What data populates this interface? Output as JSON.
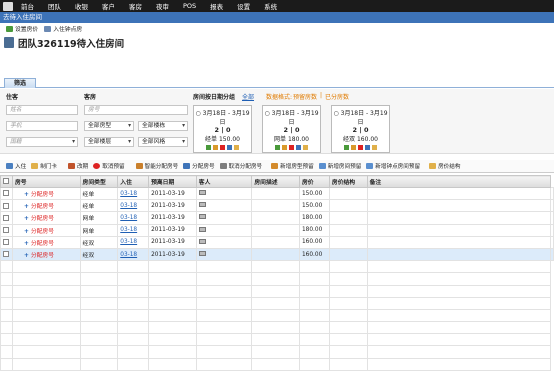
{
  "nav": {
    "items": [
      "前台",
      "团队",
      "收银",
      "客户",
      "客房",
      "夜审",
      "POS",
      "报表",
      "设置",
      "系统"
    ]
  },
  "breadcrumb": "去待入住房间",
  "toolbar": {
    "set_price": "设置房价",
    "checkin_hour": "入住钟点房"
  },
  "page_title": "团队326119待入住房间",
  "filter": {
    "tab": "筛选",
    "group_label": "住客",
    "guest_label": "客房",
    "room_stats_label": "房间按日期分组",
    "room_stats_all": "全部",
    "data_format_label": "数据格式:",
    "data_format_value": "预留房数",
    "data_format_sep": "|",
    "data_format_other": "已分房数",
    "name_placeholder": "姓名",
    "phone_placeholder": "手机",
    "country_placeholder": "国籍",
    "room_no_placeholder": "房号",
    "room_type_select": "全部房型",
    "building_select": "全部楼栋",
    "floor_select": "全部楼层",
    "style_select": "全部风格"
  },
  "room_groups": [
    {
      "dates": "3月18日 - 3月19日",
      "counts": "2 | 0",
      "type": "经单",
      "price": "150.00"
    },
    {
      "dates": "3月18日 - 3月19日",
      "counts": "2 | 0",
      "type": "网单",
      "price": "180.00"
    },
    {
      "dates": "3月18日 - 3月19日",
      "counts": "2 | 0",
      "type": "经双",
      "price": "160.00"
    }
  ],
  "actions": {
    "checkin": "入住",
    "make_card": "制门卡",
    "change_date": "改期",
    "cancel_reserve": "取消预留",
    "smart_assign": "智能分配房号",
    "assign_room": "分配房号",
    "cancel_assign": "取消分配房号",
    "add_type_reserve": "新增房型预留",
    "add_room_reserve": "新增房间预留",
    "add_hourly_reserve": "新增钟点房间预留",
    "price_structure": "房价结构"
  },
  "table": {
    "headers": [
      "房号",
      "房间类型",
      "入住",
      "预离日期",
      "客人",
      "房间描述",
      "房价",
      "房价结构",
      "备注"
    ],
    "assign_label": "分配房号",
    "rows": [
      {
        "type": "经单",
        "checkin": "03-18",
        "depart": "2011-03-19",
        "price": "150.00"
      },
      {
        "type": "经单",
        "checkin": "03-18",
        "depart": "2011-03-19",
        "price": "150.00"
      },
      {
        "type": "网单",
        "checkin": "03-18",
        "depart": "2011-03-19",
        "price": "180.00"
      },
      {
        "type": "网单",
        "checkin": "03-18",
        "depart": "2011-03-19",
        "price": "180.00"
      },
      {
        "type": "经双",
        "checkin": "03-18",
        "depart": "2011-03-19",
        "price": "160.00"
      },
      {
        "type": "经双",
        "checkin": "03-18",
        "depart": "2011-03-19",
        "price": "160.00"
      }
    ]
  },
  "colors": {
    "nav_bg": "#1b1b1b",
    "accent_blue": "#3d73b8",
    "link": "#1f5fb4",
    "danger": "#d22"
  }
}
